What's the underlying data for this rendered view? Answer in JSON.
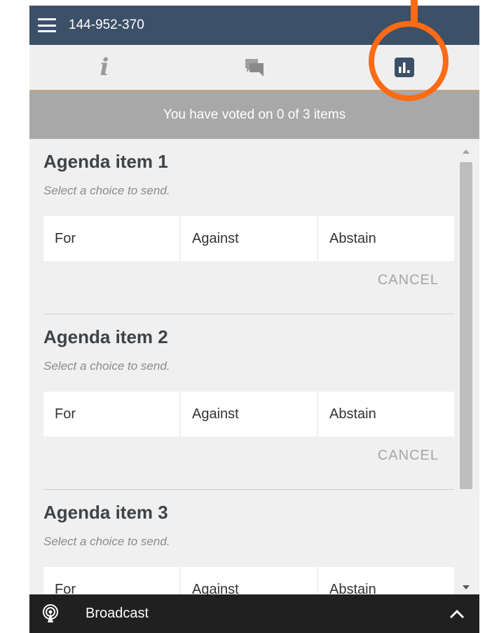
{
  "header": {
    "meeting_id": "144-952-370"
  },
  "tabs": [
    {
      "name": "info",
      "icon": "info-icon"
    },
    {
      "name": "chat",
      "icon": "chat-icon"
    },
    {
      "name": "voting",
      "icon": "poll-chart-icon",
      "active": true
    }
  ],
  "status": {
    "text": "You have voted on 0 of 3 items"
  },
  "agenda_items": [
    {
      "title": "Agenda item 1",
      "hint": "Select a choice to send.",
      "choices": [
        "For",
        "Against",
        "Abstain"
      ],
      "cancel_label": "CANCEL"
    },
    {
      "title": "Agenda item 2",
      "hint": "Select a choice to send.",
      "choices": [
        "For",
        "Against",
        "Abstain"
      ],
      "cancel_label": "CANCEL"
    },
    {
      "title": "Agenda item 3",
      "hint": "Select a choice to send.",
      "choices": [
        "For",
        "Against",
        "Abstain"
      ]
    }
  ],
  "bottom_bar": {
    "label": "Broadcast",
    "icon": "broadcast-icon",
    "toggle_icon": "chevron-up-icon"
  },
  "colors": {
    "header_bg": "#3c5068",
    "status_bg": "#a8a8a8",
    "bottom_bar_bg": "#202020",
    "highlight": "#ff6a14",
    "tab_underline": "#c8a47a"
  }
}
